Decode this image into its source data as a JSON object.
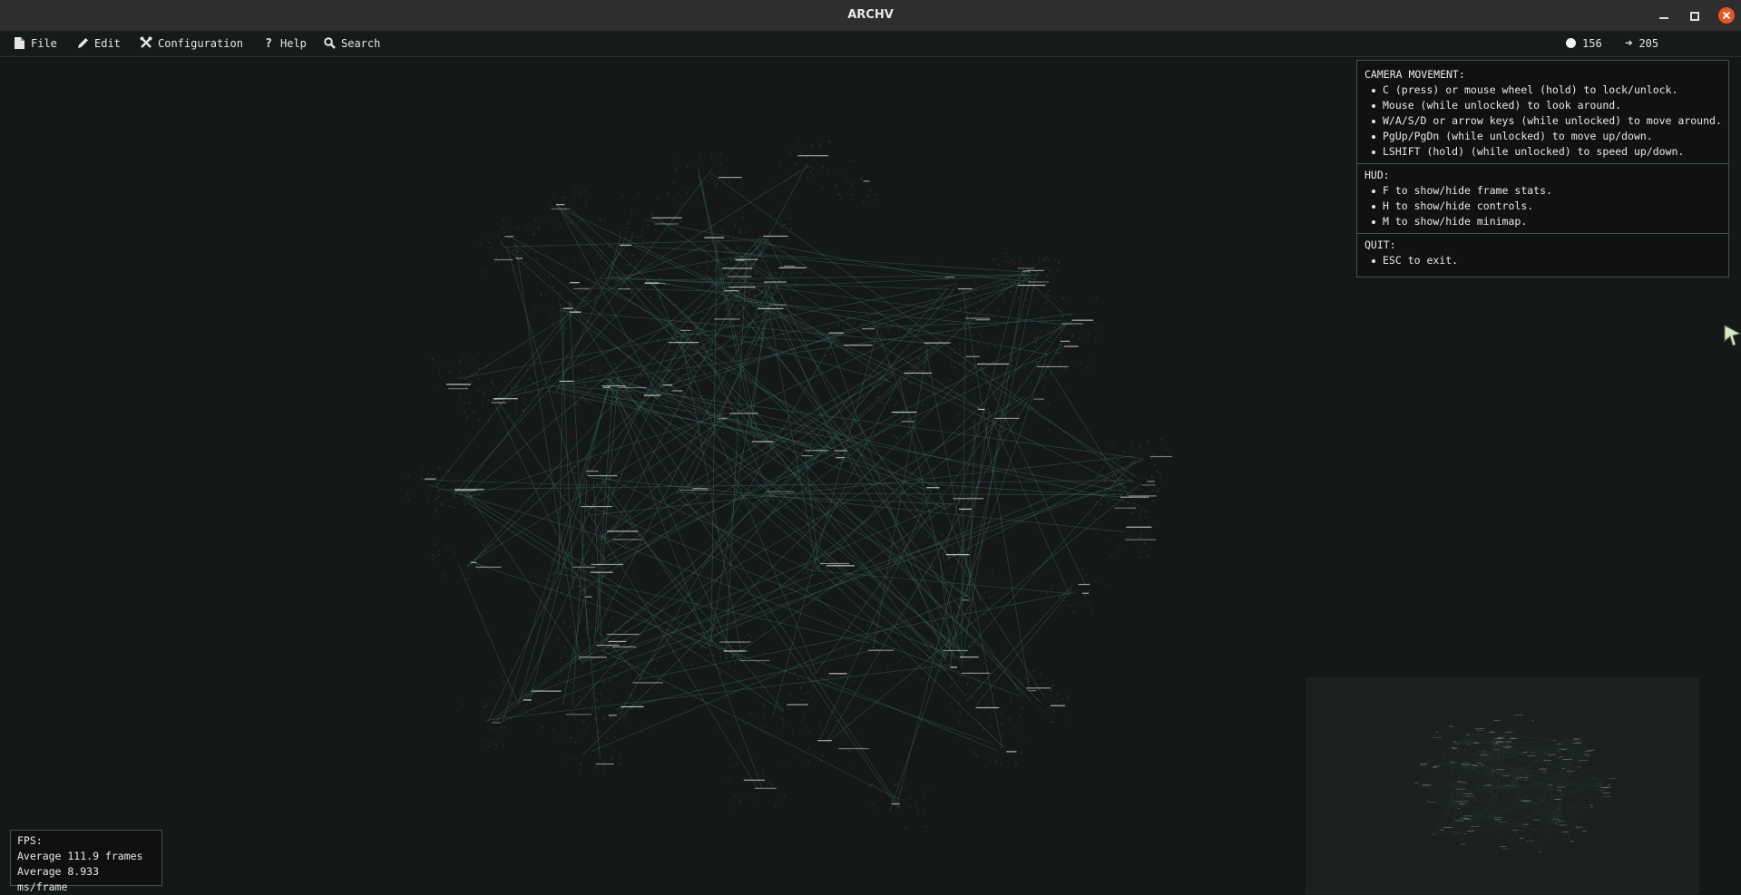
{
  "window": {
    "title": "ARCHV"
  },
  "menubar": {
    "items": [
      {
        "label": "File",
        "icon": "file-icon"
      },
      {
        "label": "Edit",
        "icon": "pencil-icon"
      },
      {
        "label": "Configuration",
        "icon": "tools-icon"
      },
      {
        "label": "Help",
        "icon": "question-icon"
      },
      {
        "label": "Search",
        "icon": "search-icon"
      }
    ],
    "node_count": "156",
    "edge_count": "205"
  },
  "help": {
    "camera_title": "CAMERA MOVEMENT:",
    "camera_items": [
      "C (press) or mouse wheel (hold) to lock/unlock.",
      "Mouse (while unlocked) to look around.",
      "W/A/S/D or arrow keys (while unlocked) to move around.",
      "PgUp/PgDn (while unlocked) to move up/down.",
      "LSHIFT (hold) (while unlocked) to speed up/down."
    ],
    "hud_title": "HUD:",
    "hud_items": [
      "F to show/hide frame stats.",
      "H to show/hide controls.",
      "M to show/hide minimap."
    ],
    "quit_title": "QUIT:",
    "quit_items": [
      "ESC to exit."
    ]
  },
  "fps": {
    "title": "FPS:",
    "frames": "Average 111.9 frames",
    "ms": "Average 8.933 ms/frame"
  },
  "colors": {
    "background": "#151818",
    "edge": "#3a6a5e",
    "node_label": "#e8e8e8",
    "panel_border": "#4a4f4f",
    "close_button": "#e95420"
  }
}
